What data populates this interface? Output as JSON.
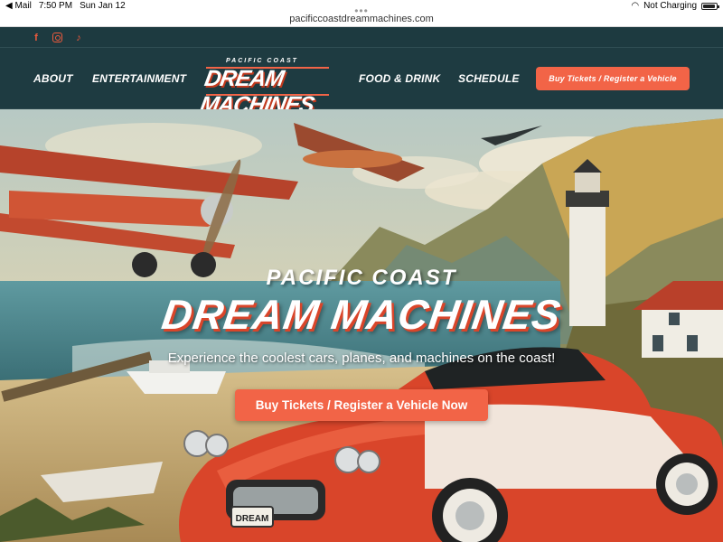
{
  "status_bar": {
    "back_app": "◀ Mail",
    "time": "7:50 PM",
    "date": "Sun Jan 12",
    "charging": "Not Charging"
  },
  "browser": {
    "url": "pacificcoastdreammachines.com"
  },
  "social": {
    "facebook": "f",
    "tiktok": "♪"
  },
  "nav": {
    "about": "ABOUT",
    "entertainment": "ENTERTAINMENT",
    "food_drink": "FOOD & DRINK",
    "schedule": "SCHEDULE",
    "cta": "Buy Tickets / Register a Vehicle"
  },
  "logo": {
    "top": "PACIFIC COAST",
    "main": "DREAM MACHINES"
  },
  "hero": {
    "title_small": "PACIFIC COAST",
    "title_big": "DREAM MACHINES",
    "tagline": "Experience the coolest cars, planes, and machines on the coast!",
    "cta": "Buy Tickets / Register a Vehicle Now",
    "car_plate": "DREAM"
  },
  "colors": {
    "accent": "#f26447",
    "nav_bg": "#1e3b41"
  }
}
